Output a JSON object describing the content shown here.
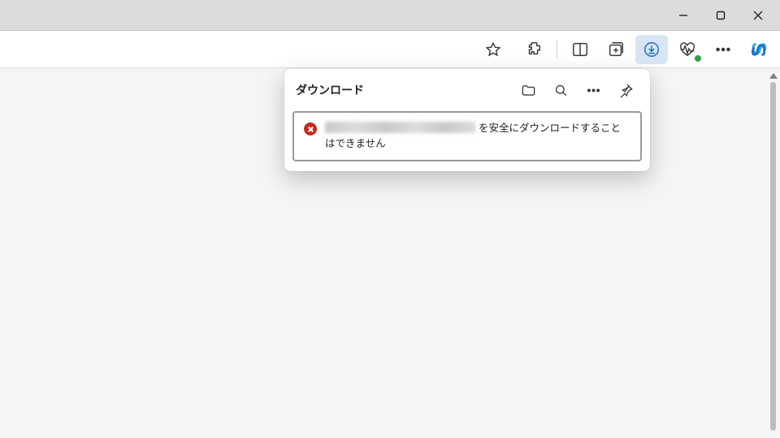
{
  "window": {
    "minimize_label": "最小化",
    "maximize_label": "最大化",
    "close_label": "閉じる"
  },
  "toolbar": {
    "favorite_label": "お気に入りに追加",
    "extensions_label": "拡張機能",
    "split_label": "画面分割",
    "collections_label": "コレクション",
    "downloads_label": "ダウンロード",
    "performance_label": "ブラウザーのパフォーマンス",
    "more_label": "設定など",
    "copilot_label": "Copilot"
  },
  "downloads_panel": {
    "title": "ダウンロード",
    "open_folder_label": "ダウンロード フォルダーを開く",
    "search_label": "検索",
    "more_label": "その他のオプション",
    "pin_label": "ピン留め",
    "items": [
      {
        "status": "error",
        "filename": "",
        "message": "を安全にダウンロードすることはできません"
      }
    ]
  }
}
